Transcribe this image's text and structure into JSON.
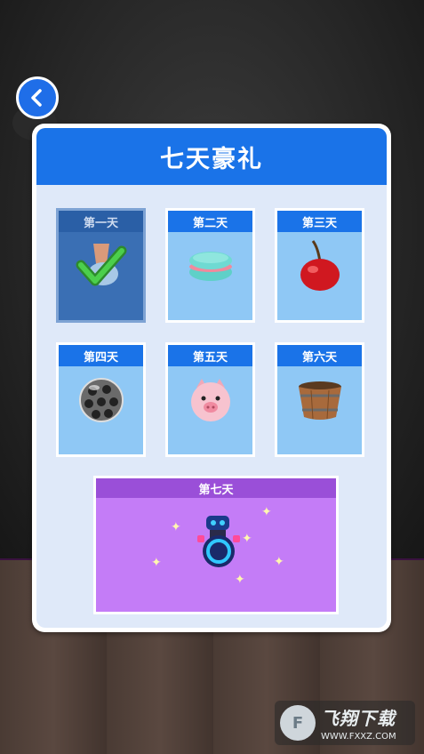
{
  "modal": {
    "title": "七天豪礼"
  },
  "days": [
    {
      "label": "第一天",
      "item_icon": "ice-cream-icon",
      "claimed": true
    },
    {
      "label": "第二天",
      "item_icon": "macaron-icon",
      "claimed": false
    },
    {
      "label": "第三天",
      "item_icon": "cherry-icon",
      "claimed": false
    },
    {
      "label": "第四天",
      "item_icon": "metal-ball-icon",
      "claimed": false
    },
    {
      "label": "第五天",
      "item_icon": "pig-icon",
      "claimed": false
    },
    {
      "label": "第六天",
      "item_icon": "wooden-bucket-icon",
      "claimed": false
    }
  ],
  "day7": {
    "label": "第七天",
    "item_icon": "robot-icon"
  },
  "watermark": {
    "title": "飞翔下载",
    "url": "WWW.FXXZ.COM"
  },
  "colors": {
    "header_blue": "#1a73e8",
    "card_blue": "#8fc8f5",
    "day7_purple": "#c47cf7"
  }
}
